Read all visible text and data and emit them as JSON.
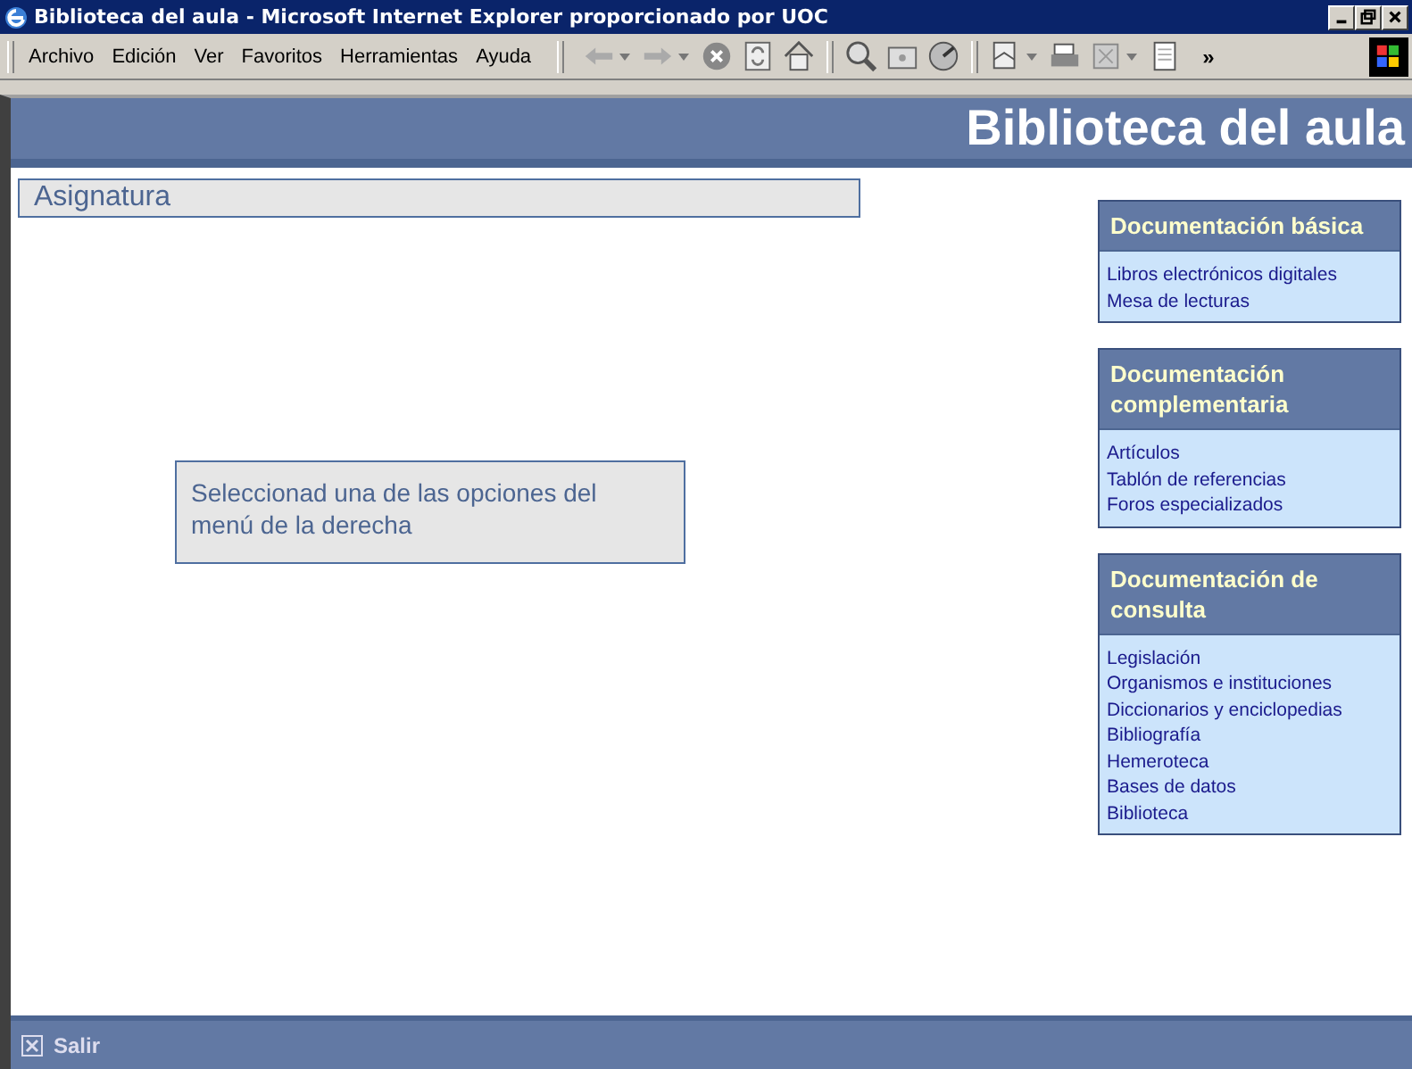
{
  "window": {
    "title": "Biblioteca del aula - Microsoft Internet Explorer proporcionado por UOC"
  },
  "menu": [
    "Archivo",
    "Edición",
    "Ver",
    "Favoritos",
    "Herramientas",
    "Ayuda"
  ],
  "toolbar_more": "»",
  "banner": {
    "title": "Biblioteca del aula"
  },
  "subject": {
    "label": "Asignatura"
  },
  "message": "Seleccionad una de las opciones del menú de la derecha",
  "sections": [
    {
      "title": "Documentación básica",
      "links": [
        "Libros electrónicos digitales",
        "Mesa de lecturas"
      ]
    },
    {
      "title": "Documentación complementaria",
      "links": [
        "Artículos",
        "Tablón de referencias",
        "Foros especializados"
      ]
    },
    {
      "title": "Documentación de consulta",
      "links": [
        "Legislación",
        "Organismos e instituciones",
        "Diccionarios y enciclopedias",
        "Bibliografía",
        "Hemeroteca",
        "Bases de datos",
        "Biblioteca"
      ]
    }
  ],
  "footer": {
    "exit": "Salir"
  }
}
